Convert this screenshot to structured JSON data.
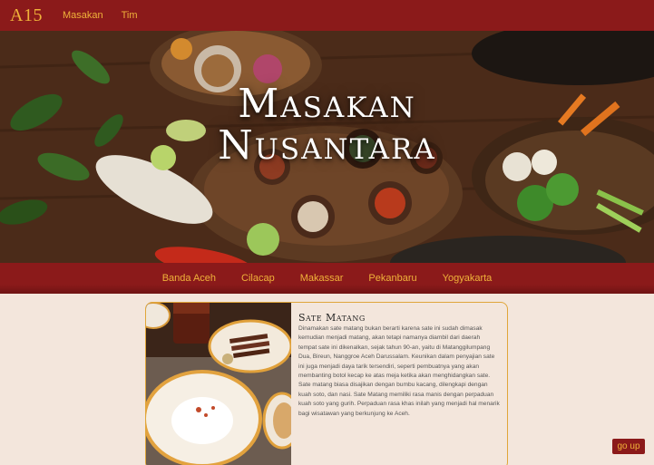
{
  "nav": {
    "logo": "A15",
    "links": [
      "Masakan",
      "Tim"
    ]
  },
  "hero": {
    "title_line1": "Masakan",
    "title_line2": "Nusantara"
  },
  "cities": [
    "Banda Aceh",
    "Cilacap",
    "Makassar",
    "Pekanbaru",
    "Yogyakarta"
  ],
  "card": {
    "title": "Sate Matang",
    "description": "Dinamakan sate matang bukan berarti karena sate ini sudah dimasak kemudian menjadi matang, akan tetapi namanya diambil dari daerah tempat sate ini dikenalkan, sejak tahun 90-an, yaitu di Matanggilumpang Dua, Bireun, Nanggroe Aceh Darussalam. Keunikan dalam penyajian sate ini juga menjadi daya tarik tersendiri, seperti pembuatnya yang akan membanting botol kecap ke atas meja ketika akan menghidangkan sate. Sate matang biasa disajikan dengan bumbu kacang, dilengkapi dengan kuah soto, dan nasi. Sate Matang memiliki rasa manis dengan perpaduan kuah soto yang gurih. Perpaduan rasa khas inilah yang menjadi hal menarik bagi wisatawan yang berkunjung ke Aceh."
  },
  "go_up_label": "go up",
  "colors": {
    "primary": "#8b1a1a",
    "accent": "#f0b23a",
    "background": "#f3e6dc"
  }
}
